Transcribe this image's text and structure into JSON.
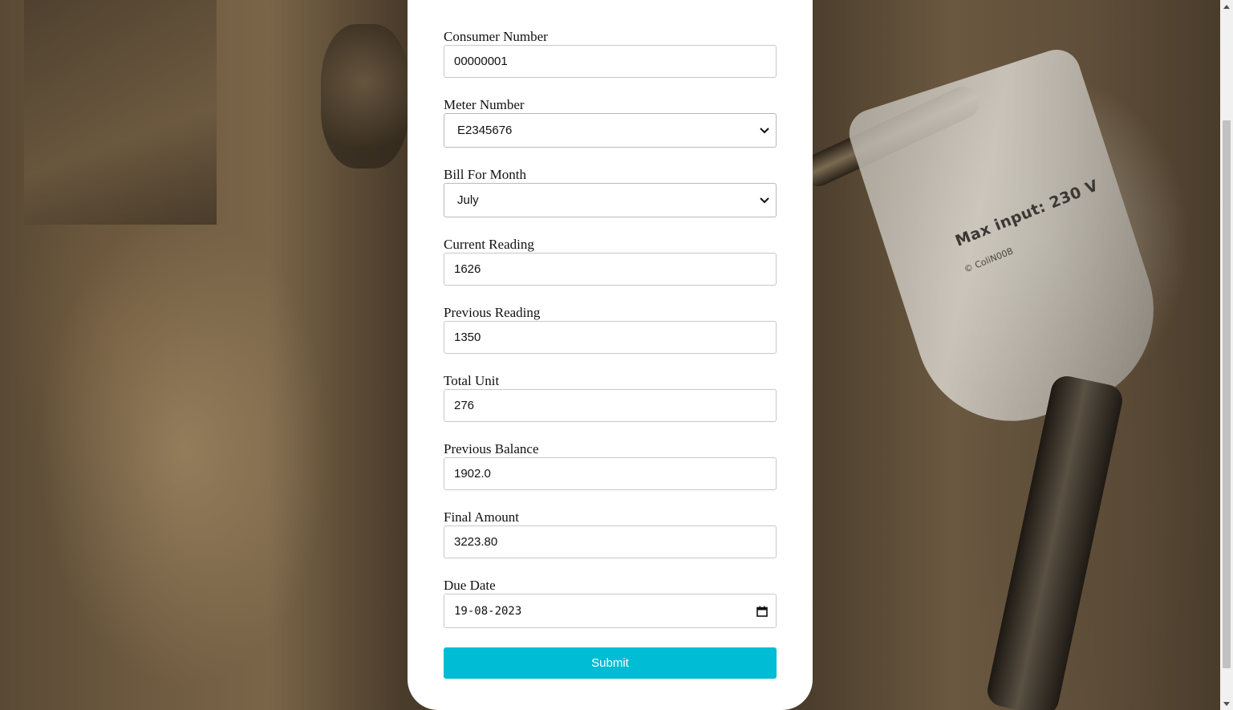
{
  "background": {
    "device_text": "Max input: 230 V",
    "device_subtext": "© ColiN00B"
  },
  "form": {
    "consumer_number": {
      "label": "Consumer Number",
      "value": "00000001"
    },
    "meter_number": {
      "label": "Meter Number",
      "value": "E2345676"
    },
    "bill_for_month": {
      "label": "Bill For Month",
      "value": "July"
    },
    "current_reading": {
      "label": "Current Reading",
      "value": "1626"
    },
    "previous_reading": {
      "label": "Previous Reading",
      "value": "1350"
    },
    "total_unit": {
      "label": "Total Unit",
      "value": "276"
    },
    "previous_balance": {
      "label": "Previous Balance",
      "value": "1902.0"
    },
    "final_amount": {
      "label": "Final Amount",
      "value": "3223.80"
    },
    "due_date": {
      "label": "Due Date",
      "value": "19-08-2023"
    },
    "submit_label": "Submit"
  },
  "colors": {
    "submit": "#00bcd4",
    "card": "#ffffff"
  },
  "icons": {
    "select": "chevron-down-icon",
    "date": "calendar-icon",
    "scroll_up": "scroll-up-arrow-icon",
    "scroll_down": "scroll-down-arrow-icon"
  }
}
